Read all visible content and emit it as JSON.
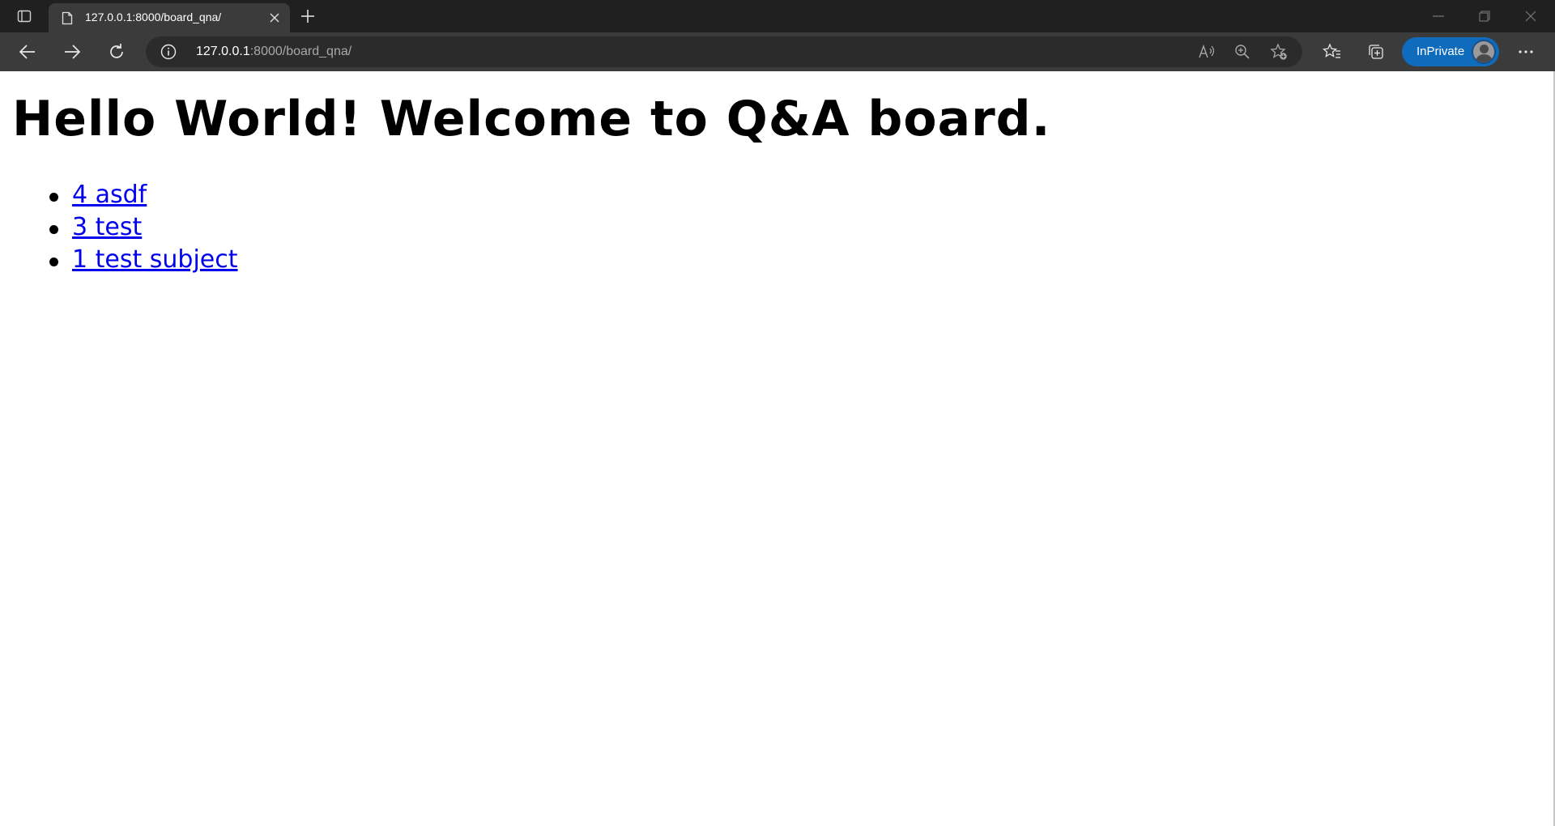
{
  "browser": {
    "tab": {
      "title": "127.0.0.1:8000/board_qna/",
      "favicon_icon": "document-icon"
    },
    "address": {
      "host": "127.0.0.1",
      "path": ":8000/board_qna/"
    },
    "inprivate_label": "InPrivate",
    "icons": {
      "tab_actions": "tab-actions-icon",
      "close_tab": "close-icon",
      "new_tab": "plus-icon",
      "back": "arrow-left-icon",
      "forward": "arrow-right-icon",
      "refresh": "refresh-icon",
      "site_info": "info-icon",
      "read_aloud": "read-aloud-icon",
      "zoom": "zoom-in-icon",
      "add_favorite": "star-add-icon",
      "favorites": "favorites-icon",
      "collections": "collections-icon",
      "more": "more-icon"
    },
    "accent_color": "#0f6cbd"
  },
  "page": {
    "title": "Hello World! Welcome to Q&A board.",
    "items": [
      {
        "label": "4 asdf"
      },
      {
        "label": "3 test"
      },
      {
        "label": "1 test subject"
      }
    ],
    "link_color": "#0000ee"
  }
}
